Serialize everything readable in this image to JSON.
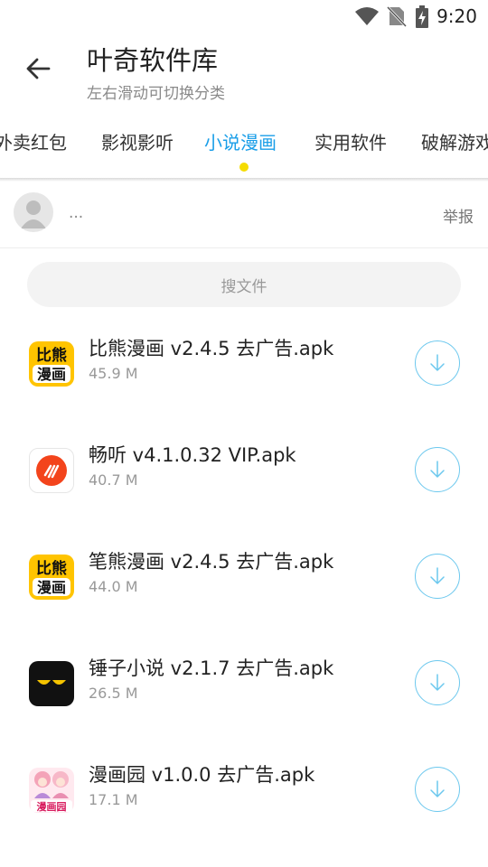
{
  "status_bar": {
    "time": "9:20",
    "icons": [
      "wifi-icon",
      "no-sim-icon",
      "battery-charging-icon"
    ]
  },
  "header": {
    "title": "叶奇软件库",
    "subtitle": "左右滑动可切换分类",
    "back_icon": "arrow-left-icon"
  },
  "tabs": [
    {
      "label": "外卖红包",
      "active": false
    },
    {
      "label": "影视影听",
      "active": false
    },
    {
      "label": "小说漫画",
      "active": true
    },
    {
      "label": "实用软件",
      "active": false
    },
    {
      "label": "破解游戏",
      "active": false
    }
  ],
  "colors": {
    "accent": "#1a9ee8",
    "indicator": "#f5dc00",
    "download_ring": "#6cc8ee"
  },
  "user": {
    "name": "...",
    "report": "举报"
  },
  "search": {
    "placeholder": "搜文件"
  },
  "files": [
    {
      "name": "比熊漫画 v2.4.5 去广告.apk",
      "size": "45.9 M",
      "icon": "bixiong-comic-app-icon",
      "icon_text": [
        "比熊",
        "漫画"
      ]
    },
    {
      "name": "畅听 v4.1.0.32 VIP.apk",
      "size": "40.7 M",
      "icon": "changting-app-icon"
    },
    {
      "name": "笔熊漫画 v2.4.5 去广告.apk",
      "size": "44.0 M",
      "icon": "bixiong-comic-app-icon",
      "icon_text": [
        "比熊",
        "漫画"
      ]
    },
    {
      "name": "锤子小说 v2.1.7 去广告.apk",
      "size": "26.5 M",
      "icon": "chuizi-novel-app-icon"
    },
    {
      "name": "漫画园 v1.0.0 去广告.apk",
      "size": "17.1 M",
      "icon": "manhuayuan-app-icon",
      "icon_text": [
        "漫画园"
      ]
    }
  ]
}
